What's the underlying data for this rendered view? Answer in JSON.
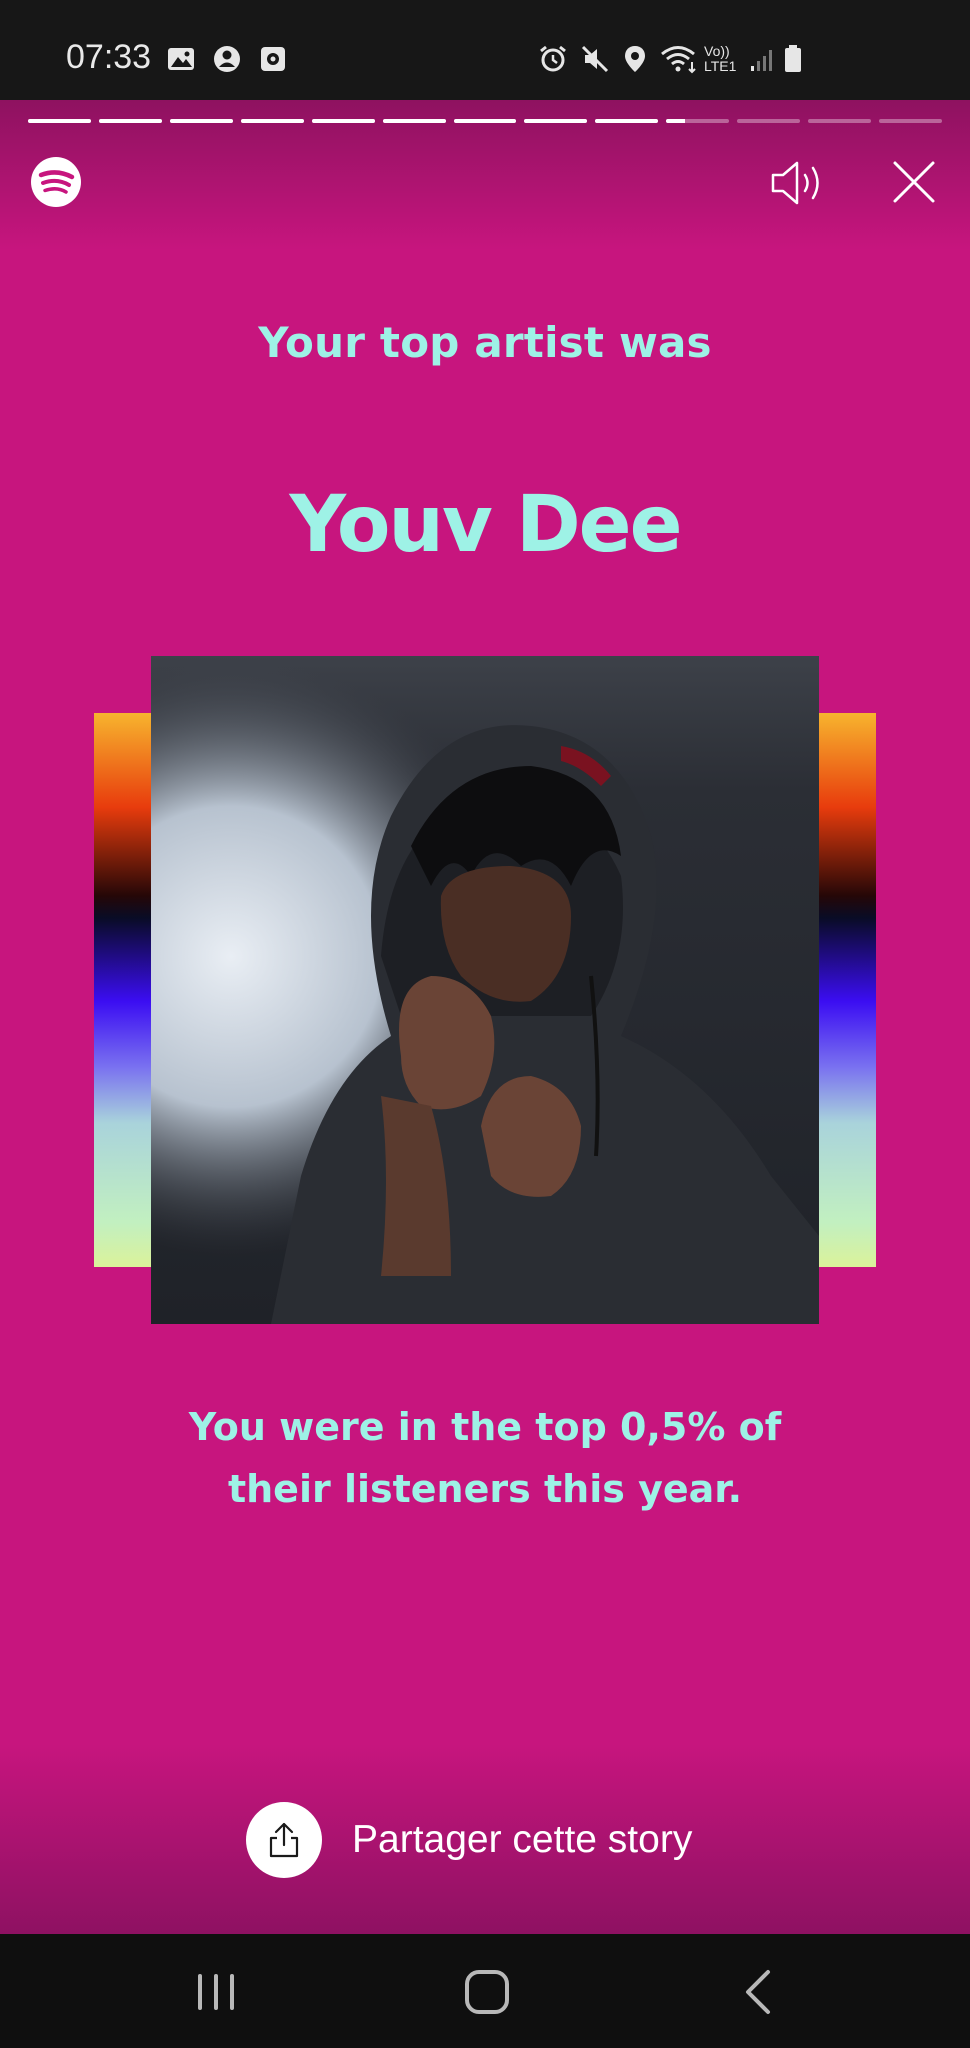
{
  "status_bar": {
    "time": "07:33",
    "left_icons": [
      "gallery-icon",
      "account-icon",
      "screenshot-icon"
    ],
    "right_icons": [
      "alarm-icon",
      "mute-icon",
      "location-icon",
      "wifi-icon",
      "volte-icon",
      "signal-icon",
      "battery-icon"
    ],
    "lte_label_line1": "Vo))",
    "lte_label_line2": "LTE1"
  },
  "story": {
    "progress": {
      "segments_total": 13,
      "segments_completed": 9,
      "current_segment_fraction": 0.3
    },
    "heading": "Your top artist was",
    "artist_name": "Youv Dee",
    "stat_text": "You were in the top 0,5% of their listeners this year.",
    "share_label": "Partager cette story",
    "colors": {
      "background": "#c7157e",
      "accent_text": "#9ef2e6"
    }
  },
  "navbar": {
    "buttons": [
      "recent-apps-icon",
      "home-icon",
      "back-icon"
    ]
  }
}
